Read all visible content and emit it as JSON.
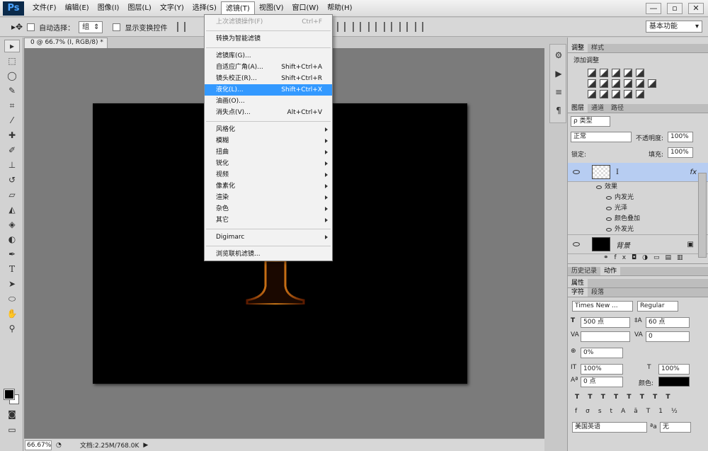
{
  "app": {
    "logo": "Ps",
    "menus": [
      "文件(F)",
      "编辑(E)",
      "图像(I)",
      "图层(L)",
      "文字(Y)",
      "选择(S)",
      "滤镜(T)",
      "视图(V)",
      "窗口(W)",
      "帮助(H)"
    ],
    "window_buttons": [
      "—",
      "▫",
      "✕"
    ]
  },
  "options": {
    "auto_select_label": "自动选择：",
    "auto_select_value": "组",
    "show_transform_label": "显示变换控件",
    "workspace": "基本功能"
  },
  "document": {
    "tab_label": "0 @ 66.7% (I, RGB/8) *",
    "zoom": "66.67%",
    "doc_info": "文档:2.25M/768.0K",
    "glyph_color": "#e07a10"
  },
  "filter_menu": {
    "items": [
      {
        "label": "上次滤镜操作(F)",
        "shortcut": "Ctrl+F",
        "disabled": true
      },
      {
        "sep": true
      },
      {
        "label": "转换为智能滤镜"
      },
      {
        "sep": true
      },
      {
        "label": "滤镜库(G)..."
      },
      {
        "label": "自适应广角(A)...",
        "shortcut": "Shift+Ctrl+A"
      },
      {
        "label": "镜头校正(R)...",
        "shortcut": "Shift+Ctrl+R"
      },
      {
        "label": "液化(L)...",
        "shortcut": "Shift+Ctrl+X",
        "highlight": true
      },
      {
        "label": "油画(O)..."
      },
      {
        "label": "消失点(V)...",
        "shortcut": "Alt+Ctrl+V"
      },
      {
        "sep": true
      },
      {
        "label": "风格化",
        "submenu": true
      },
      {
        "label": "模糊",
        "submenu": true
      },
      {
        "label": "扭曲",
        "submenu": true
      },
      {
        "label": "锐化",
        "submenu": true
      },
      {
        "label": "视频",
        "submenu": true
      },
      {
        "label": "像素化",
        "submenu": true
      },
      {
        "label": "渲染",
        "submenu": true
      },
      {
        "label": "杂色",
        "submenu": true
      },
      {
        "label": "其它",
        "submenu": true
      },
      {
        "sep": true
      },
      {
        "label": "Digimarc",
        "submenu": true
      },
      {
        "sep": true
      },
      {
        "label": "浏览联机滤镜..."
      }
    ]
  },
  "adjustments": {
    "tabs": [
      "调整",
      "样式"
    ],
    "title": "添加调整"
  },
  "layers": {
    "tabs": [
      "图层",
      "通道",
      "路径"
    ],
    "kind_filter": "ρ 类型",
    "blend_mode": "正常",
    "opacity_label": "不透明度:",
    "opacity": "100%",
    "lock_label": "锁定:",
    "fill_label": "填充:",
    "fill": "100%",
    "items": [
      {
        "name": "I",
        "fx": "fx"
      },
      {
        "name": "背景"
      }
    ],
    "effects_label": "效果",
    "effects": [
      "内发光",
      "光泽",
      "颜色叠加",
      "外发光"
    ]
  },
  "history": {
    "tabs": [
      "历史记录",
      "动作"
    ],
    "properties_label": "属性"
  },
  "character": {
    "tabs": [
      "字符",
      "段落"
    ],
    "font_family": "Times New ...",
    "font_style": "Regular",
    "font_size": "500 点",
    "leading": "60 点",
    "tracking": "0",
    "scale_pct": "0%",
    "vscale": "100%",
    "hscale": "100%",
    "baseline": "0 点",
    "color_label": "颜色:",
    "language": "美国英语",
    "aa_value": "无"
  }
}
